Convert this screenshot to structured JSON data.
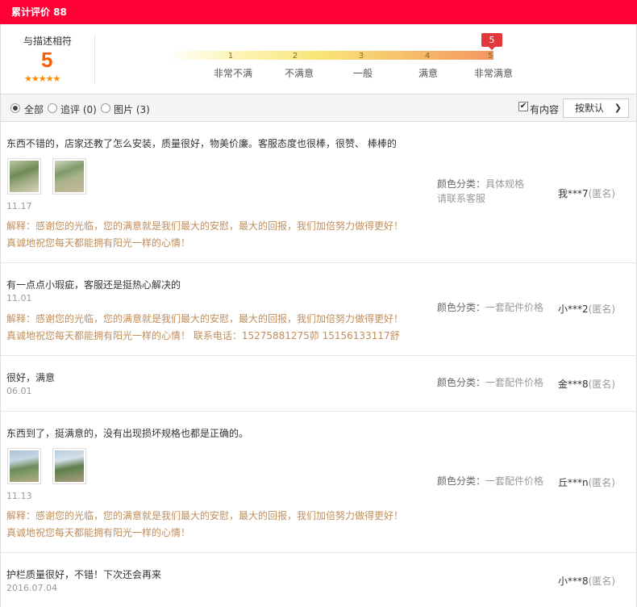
{
  "header": {
    "title": "累计评价 88"
  },
  "score": {
    "label": "与描述相符",
    "value": "5",
    "stars": "★★★★★",
    "marker": "5",
    "ticks": [
      "1",
      "2",
      "3",
      "4",
      "5"
    ],
    "levels": [
      "非常不满",
      "不满意",
      "一般",
      "满意",
      "非常满意"
    ]
  },
  "filter": {
    "all": "全部",
    "followup": "追评 (0)",
    "pictures": "图片 (3)",
    "has_content": "有内容",
    "sort": "按默认"
  },
  "reviews": [
    {
      "text": "东西不错的，店家还教了怎么安装，质量很好，物美价廉。客服态度也很棒，很赞、 棒棒的",
      "date": "11.17",
      "reply1": "解释：感谢您的光临，您的满意就是我们最大的安慰，最大的回报，我们加倍努力做得更好！",
      "reply2": "真诚地祝您每天都能拥有阳光一样的心情！",
      "color_label": "颜色分类：",
      "color_value": "具体规格请联系客服",
      "user": "我***7",
      "anon": "(匿名)"
    },
    {
      "text": "有一点点小瑕疵，客服还是挺热心解决的",
      "date": "11.01",
      "reply1": "解释：感谢您的光临，您的满意就是我们最大的安慰，最大的回报，我们加倍努力做得更好！",
      "reply2": "真诚地祝您每天都能拥有阳光一样的心情！ 联系电话：15275881275茆 15156133117舒",
      "color_label": "颜色分类：",
      "color_value": "一套配件价格",
      "user": "小***2",
      "anon": "(匿名)"
    },
    {
      "text": "很好，满意",
      "date": "06.01",
      "color_label": "颜色分类：",
      "color_value": "一套配件价格",
      "user": "金***8",
      "anon": "(匿名)"
    },
    {
      "text": "东西到了，挺满意的，没有出现损坏规格也都是正确的。",
      "date": "11.13",
      "reply1": "解释：感谢您的光临，您的满意就是我们最大的安慰，最大的回报，我们加倍努力做得更好！",
      "reply2": "真诚地祝您每天都能拥有阳光一样的心情！",
      "color_label": "颜色分类：",
      "color_value": "一套配件价格",
      "user": "丘***n",
      "anon": "(匿名)"
    },
    {
      "text": "护栏质量很好，不错！下次还会再来",
      "date": "2016.07.04",
      "user": "小***8",
      "anon": "(匿名)"
    }
  ]
}
